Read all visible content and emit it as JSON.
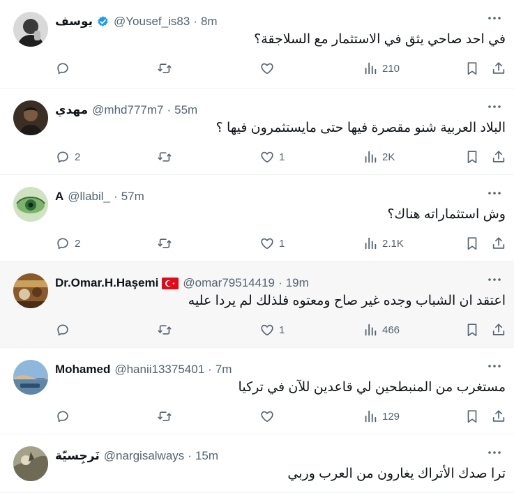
{
  "tweets": [
    {
      "name": "يوسف",
      "verified": true,
      "flag": false,
      "handle": "@Yousef_is83",
      "time": "8m",
      "text": "في احد صاحي يثق في الاستثمار مع السلاجقة؟",
      "replies": "",
      "retweets": "",
      "likes": "",
      "views": "210"
    },
    {
      "name": "مهدي",
      "verified": false,
      "flag": false,
      "handle": "@mhd777m7",
      "time": "55m",
      "text": "البلاد العربية شنو مقصرة فيها حتى مايستثمرون فيها ؟",
      "replies": "2",
      "retweets": "",
      "likes": "1",
      "views": "2K"
    },
    {
      "name": "A",
      "verified": false,
      "flag": false,
      "handle": "@llabil_",
      "time": "57m",
      "text": "وش استثماراته هناك؟",
      "replies": "2",
      "retweets": "",
      "likes": "1",
      "views": "2.1K"
    },
    {
      "name": "Dr.Omar.H.Haşemi",
      "verified": false,
      "flag": true,
      "handle": "@omar79514419",
      "time": "19m",
      "text": "اعتقد ان الشباب وجده غير صاح ومعتوه فلذلك لم يردا عليه",
      "replies": "",
      "retweets": "",
      "likes": "1",
      "views": "466"
    },
    {
      "name": "Mohamed",
      "verified": false,
      "flag": false,
      "handle": "@hanii13375401",
      "time": "7m",
      "text": "مستغرب من المنبطحين لي قاعدين للآن في تركيا",
      "replies": "",
      "retweets": "",
      "likes": "",
      "views": "129"
    },
    {
      "name": "نَرجِسيّة",
      "verified": false,
      "flag": false,
      "handle": "@nargisalways",
      "time": "15m",
      "text": "ترا صدك الأتراك يغارون من العرب وربي",
      "replies": "",
      "retweets": "",
      "likes": "",
      "views": ""
    }
  ],
  "ui": {
    "separator": "·",
    "text_color": "#0f1419",
    "muted_color": "#536471",
    "verified_color": "#1d9bf0",
    "flag_color": "#e30a17",
    "highlight_background": "#f7f7f7"
  },
  "icons": {
    "reply": "reply-icon",
    "retweet": "retweet-icon",
    "like": "heart-icon",
    "views": "views-chart-icon",
    "bookmark": "bookmark-icon",
    "share": "share-icon",
    "more": "more-dots-icon",
    "verified": "verified-badge-icon",
    "flag": "turkey-flag-icon"
  }
}
